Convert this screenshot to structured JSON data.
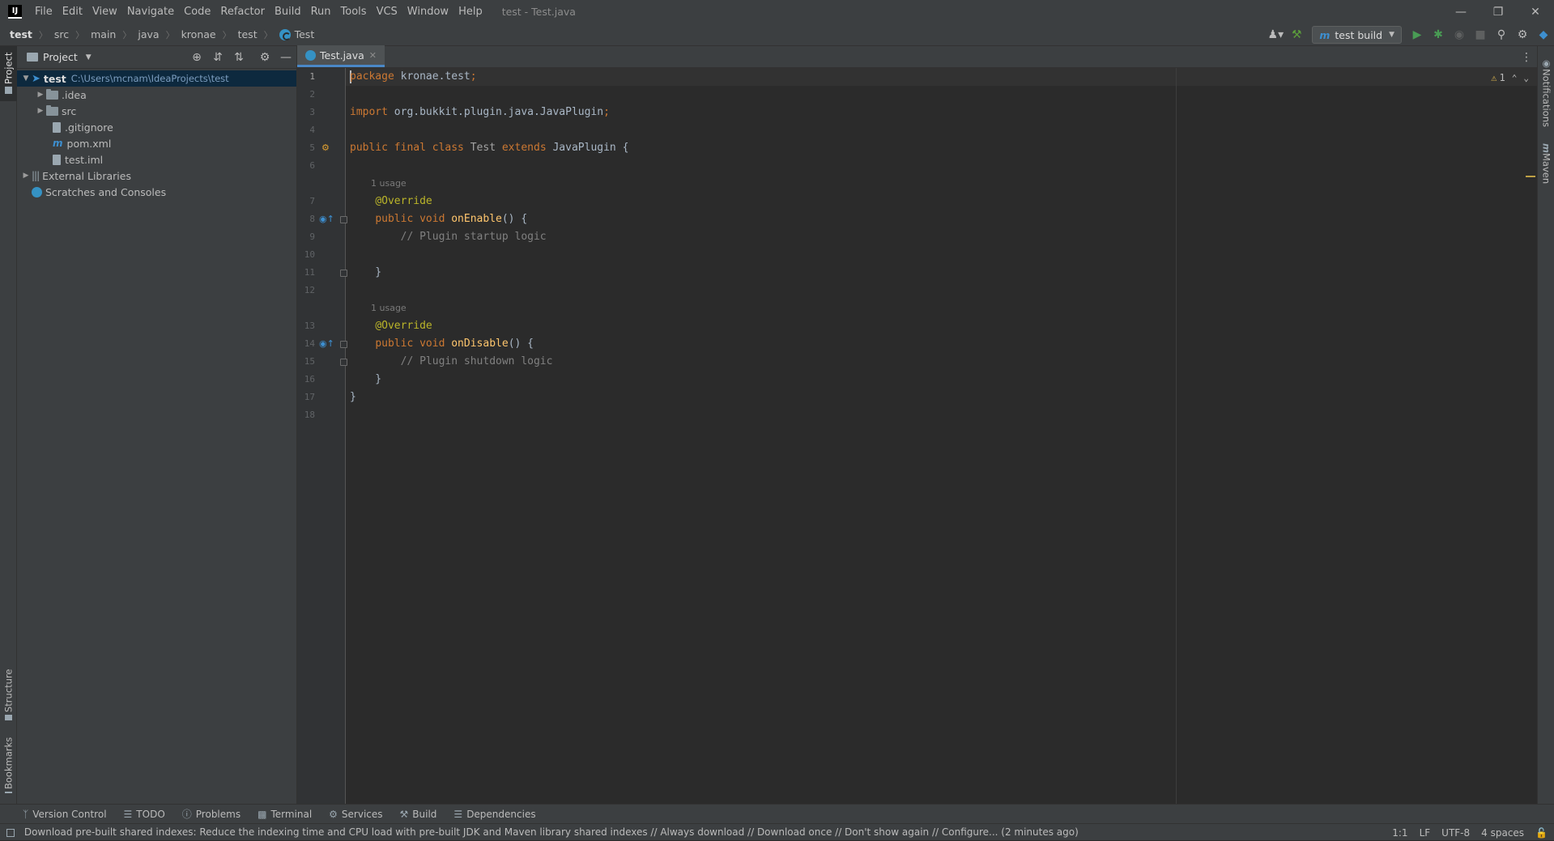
{
  "menu": {
    "items": [
      "File",
      "Edit",
      "View",
      "Navigate",
      "Code",
      "Refactor",
      "Build",
      "Run",
      "Tools",
      "VCS",
      "Window",
      "Help"
    ],
    "window_title": "test - Test.java",
    "logo": "IJ"
  },
  "breadcrumb": {
    "items": [
      "test",
      "src",
      "main",
      "java",
      "kronae",
      "test",
      "Test"
    ]
  },
  "toolbar": {
    "run_config": "test build"
  },
  "left_strip": {
    "project_label": "Project",
    "structure_label": "Structure",
    "bookmarks_label": "Bookmarks"
  },
  "right_strip": {
    "notifications_label": "Notifications",
    "maven_label": "Maven"
  },
  "project_panel": {
    "title": "Project",
    "tree": {
      "root_name": "test",
      "root_path": "C:\\Users\\mcnam\\IdeaProjects\\test",
      "idea": ".idea",
      "src": "src",
      "gitignore": ".gitignore",
      "pom": "pom.xml",
      "iml": "test.iml",
      "external_libraries": "External Libraries",
      "scratches": "Scratches and Consoles"
    }
  },
  "editor": {
    "tab_name": "Test.java",
    "warning_count": "1",
    "lines": [
      {
        "n": "1",
        "text": "package kronae.test;"
      },
      {
        "n": "2",
        "text": ""
      },
      {
        "n": "3",
        "text": "import org.bukkit.plugin.java.JavaPlugin;"
      },
      {
        "n": "4",
        "text": ""
      },
      {
        "n": "5",
        "text": "public final class Test extends JavaPlugin {"
      },
      {
        "n": "6",
        "text": ""
      },
      {
        "hint": "1 usage"
      },
      {
        "n": "7",
        "text": "    @Override"
      },
      {
        "n": "8",
        "text": "    public void onEnable() {"
      },
      {
        "n": "9",
        "text": "        // Plugin startup logic"
      },
      {
        "n": "10",
        "text": ""
      },
      {
        "n": "11",
        "text": "    }"
      },
      {
        "n": "12",
        "text": ""
      },
      {
        "hint": "1 usage"
      },
      {
        "n": "13",
        "text": "    @Override"
      },
      {
        "n": "14",
        "text": "    public void onDisable() {"
      },
      {
        "n": "15",
        "text": "        // Plugin shutdown logic"
      },
      {
        "n": "16",
        "text": "    }"
      },
      {
        "n": "17",
        "text": "}"
      },
      {
        "n": "18",
        "text": ""
      }
    ]
  },
  "bottom_tools": [
    "Version Control",
    "TODO",
    "Problems",
    "Terminal",
    "Services",
    "Build",
    "Dependencies"
  ],
  "status": {
    "message": "Download pre-built shared indexes: Reduce the indexing time and CPU load with pre-built JDK and Maven library shared indexes // Always download // Download once // Don't show again // Configure... (2 minutes ago)",
    "position": "1:1",
    "line_sep": "LF",
    "encoding": "UTF-8",
    "indent": "4 spaces"
  }
}
